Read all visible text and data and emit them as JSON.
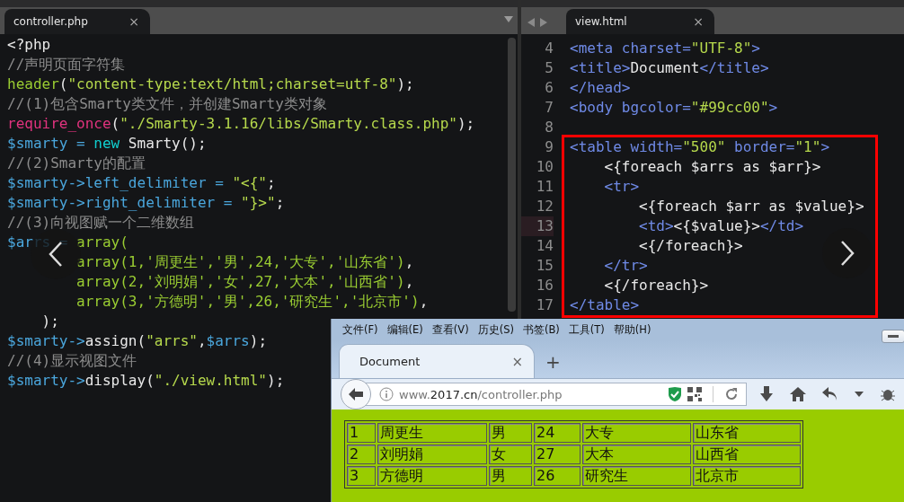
{
  "left_pane": {
    "tab": {
      "label": "controller.php",
      "close": "×",
      "selected": true
    },
    "lines": [
      {
        "tokens": [
          {
            "text": "<?php",
            "kind": "plain"
          }
        ]
      },
      {
        "tokens": [
          {
            "text": "//声明页面字符集",
            "kind": "comment"
          }
        ]
      },
      {
        "tokens": [
          {
            "text": "header",
            "kind": "func"
          },
          {
            "text": "(",
            "kind": "plain"
          },
          {
            "text": "\"content-type:text/html;charset=utf-8\"",
            "kind": "string"
          },
          {
            "text": ");",
            "kind": "plain"
          }
        ]
      },
      {
        "tokens": [
          {
            "text": "//(1)包含Smarty类文件，并创建Smarty类对象",
            "kind": "comment"
          }
        ]
      },
      {
        "tokens": [
          {
            "text": "require_once",
            "kind": "builtin"
          },
          {
            "text": "(",
            "kind": "plain"
          },
          {
            "text": "\"./Smarty-3.1.16/libs/Smarty.class.php\"",
            "kind": "string"
          },
          {
            "text": ");",
            "kind": "plain"
          }
        ]
      },
      {
        "tokens": [
          {
            "text": "$smarty = ",
            "kind": "variable"
          },
          {
            "text": "new",
            "kind": "keyword"
          },
          {
            "text": " Smarty();",
            "kind": "plain"
          }
        ]
      },
      {
        "tokens": [
          {
            "text": "//(2)Smarty的配置",
            "kind": "comment"
          }
        ]
      },
      {
        "tokens": [
          {
            "text": "$smarty->left_delimiter = ",
            "kind": "variable"
          },
          {
            "text": "\"<{\"",
            "kind": "string"
          },
          {
            "text": ";",
            "kind": "plain"
          }
        ]
      },
      {
        "tokens": [
          {
            "text": "$smarty->right_delimiter = ",
            "kind": "variable"
          },
          {
            "text": "\"}>\"",
            "kind": "string"
          },
          {
            "text": ";",
            "kind": "plain"
          }
        ]
      },
      {
        "tokens": [
          {
            "text": "//(3)向视图赋一个二维数组",
            "kind": "comment"
          }
        ]
      },
      {
        "tokens": [
          {
            "text": "$arrs = ",
            "kind": "variable"
          },
          {
            "text": "array(",
            "kind": "func"
          }
        ]
      },
      {
        "tokens": [
          {
            "text": "        array(1,'周更生','男',24,'大专','山东省')",
            "kind": "func"
          },
          {
            "text": ",",
            "kind": "plain"
          }
        ]
      },
      {
        "tokens": [
          {
            "text": "        array(2,'刘明娟','女',27,'大本','山西省')",
            "kind": "func"
          },
          {
            "text": ",",
            "kind": "plain"
          }
        ]
      },
      {
        "tokens": [
          {
            "text": "        array(3,'方德明','男',26,'研究生','北京市')",
            "kind": "func"
          },
          {
            "text": ",",
            "kind": "plain"
          }
        ]
      },
      {
        "tokens": [
          {
            "text": "    );",
            "kind": "plain"
          }
        ]
      },
      {
        "tokens": [
          {
            "text": "$smarty->",
            "kind": "variable"
          },
          {
            "text": "assign(",
            "kind": "plain"
          },
          {
            "text": "\"arrs\"",
            "kind": "string"
          },
          {
            "text": ",",
            "kind": "plain"
          },
          {
            "text": "$arrs",
            "kind": "variable"
          },
          {
            "text": ");",
            "kind": "plain"
          }
        ]
      },
      {
        "tokens": [
          {
            "text": "//(4)显示视图文件",
            "kind": "comment"
          }
        ]
      },
      {
        "tokens": [
          {
            "text": "$smarty->",
            "kind": "variable"
          },
          {
            "text": "display(",
            "kind": "plain"
          },
          {
            "text": "\"./view.html\"",
            "kind": "string"
          },
          {
            "text": ");",
            "kind": "plain"
          }
        ]
      }
    ]
  },
  "right_pane": {
    "tab": {
      "label": "view.html",
      "close": "×",
      "selected": true
    },
    "lines": [
      {
        "number": "4",
        "current": false,
        "tokens": [
          {
            "text": "<meta charset=",
            "kind": "tag"
          },
          {
            "text": "\"UTF-8\"",
            "kind": "string"
          },
          {
            "text": ">",
            "kind": "tag"
          }
        ]
      },
      {
        "number": "5",
        "current": false,
        "tokens": [
          {
            "text": "<title>",
            "kind": "tag"
          },
          {
            "text": "Document",
            "kind": "plain"
          },
          {
            "text": "</title>",
            "kind": "tag"
          }
        ]
      },
      {
        "number": "6",
        "current": false,
        "tokens": [
          {
            "text": "</head>",
            "kind": "tag"
          }
        ]
      },
      {
        "number": "7",
        "current": false,
        "tokens": [
          {
            "text": "<body bgcolor=",
            "kind": "tag"
          },
          {
            "text": "\"#99cc00\"",
            "kind": "string"
          },
          {
            "text": ">",
            "kind": "tag"
          }
        ]
      },
      {
        "number": "8",
        "current": false
      }
    ],
    "highlight_box": {
      "lines": [
        {
          "number": "9",
          "current": false,
          "tokens": [
            {
              "text": "<table width=",
              "kind": "tag"
            },
            {
              "text": "\"500\"",
              "kind": "string"
            },
            {
              "text": " border=",
              "kind": "tag"
            },
            {
              "text": "\"1\"",
              "kind": "string"
            },
            {
              "text": ">",
              "kind": "tag"
            }
          ]
        },
        {
          "number": "10",
          "current": false,
          "tokens": [
            {
              "text": "    <{foreach $arrs as $arr}>",
              "kind": "plain"
            }
          ]
        },
        {
          "number": "11",
          "current": false,
          "tokens": [
            {
              "text": "    <tr>",
              "kind": "tag"
            }
          ]
        },
        {
          "number": "12",
          "current": false,
          "tokens": [
            {
              "text": "        <{foreach $arr as $value}>",
              "kind": "plain"
            }
          ]
        },
        {
          "number": "13",
          "current": true,
          "tokens": [
            {
              "text": "        <td>",
              "kind": "tag"
            },
            {
              "text": "<{$value}>",
              "kind": "plain"
            },
            {
              "text": "</td>",
              "kind": "tag"
            }
          ]
        },
        {
          "number": "14",
          "current": false,
          "tokens": [
            {
              "text": "        <{/foreach}>",
              "kind": "plain"
            }
          ]
        },
        {
          "number": "15",
          "current": false,
          "tokens": [
            {
              "text": "    </tr>",
              "kind": "tag"
            }
          ]
        },
        {
          "number": "16",
          "current": false,
          "tokens": [
            {
              "text": "    <{/foreach}>",
              "kind": "plain"
            }
          ]
        },
        {
          "number": "17",
          "current": false,
          "tokens": [
            {
              "text": "</table>",
              "kind": "tag"
            }
          ]
        }
      ]
    }
  },
  "browser": {
    "menu": [
      "文件(F)",
      "编辑(E)",
      "查看(V)",
      "历史(S)",
      "书签(B)",
      "工具(T)",
      "帮助(H)"
    ],
    "tab": {
      "label": "Document",
      "close": "×",
      "selected": true
    },
    "new_tab": "+",
    "url": "www.**2017.cn**/controller.php",
    "table": {
      "rows": [
        [
          "1",
          "周更生",
          "男",
          "24",
          "大专",
          "山东省"
        ],
        [
          "2",
          "刘明娟",
          "女",
          "27",
          "大本",
          "山西省"
        ],
        [
          "3",
          "方德明",
          "男",
          "26",
          "研究生",
          "北京市"
        ]
      ]
    }
  }
}
